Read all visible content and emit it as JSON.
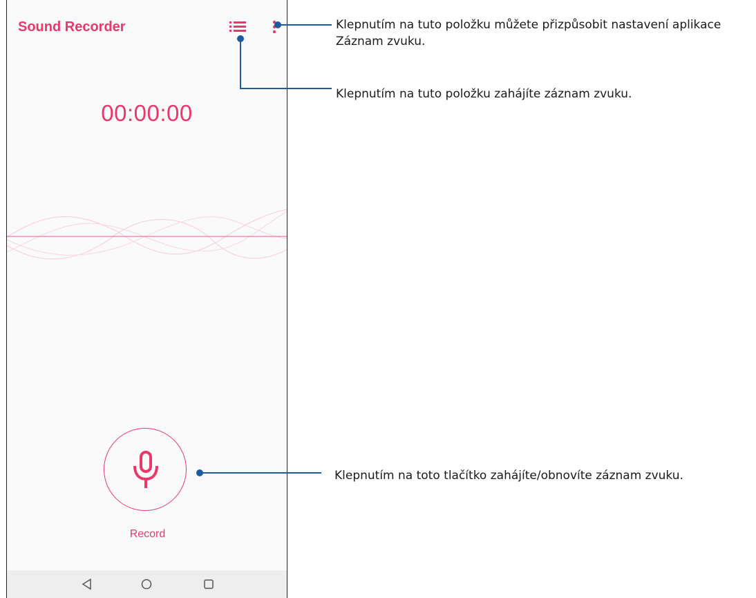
{
  "theme": {
    "accent": "#e8386a",
    "wave": "#f3bccb",
    "annotation": "#1e5aa0"
  },
  "app": {
    "title": "Sound Recorder",
    "timer": "00:00:00",
    "record_label": "Record"
  },
  "icons": {
    "list": "list-icon",
    "more": "more-vert-icon",
    "mic": "microphone-icon",
    "back": "nav-back-icon",
    "home": "nav-home-icon",
    "recents": "nav-recents-icon"
  },
  "annotations": {
    "settings": {
      "line1": "Klepnutím na tuto položku můžete přizpůsobit nastavení aplikace",
      "line2": "Záznam zvuku."
    },
    "list": "Klepnutím na tuto položku zahájíte záznam zvuku.",
    "record": "Klepnutím na toto tlačítko zahájíte/obnovíte záznam zvuku."
  }
}
